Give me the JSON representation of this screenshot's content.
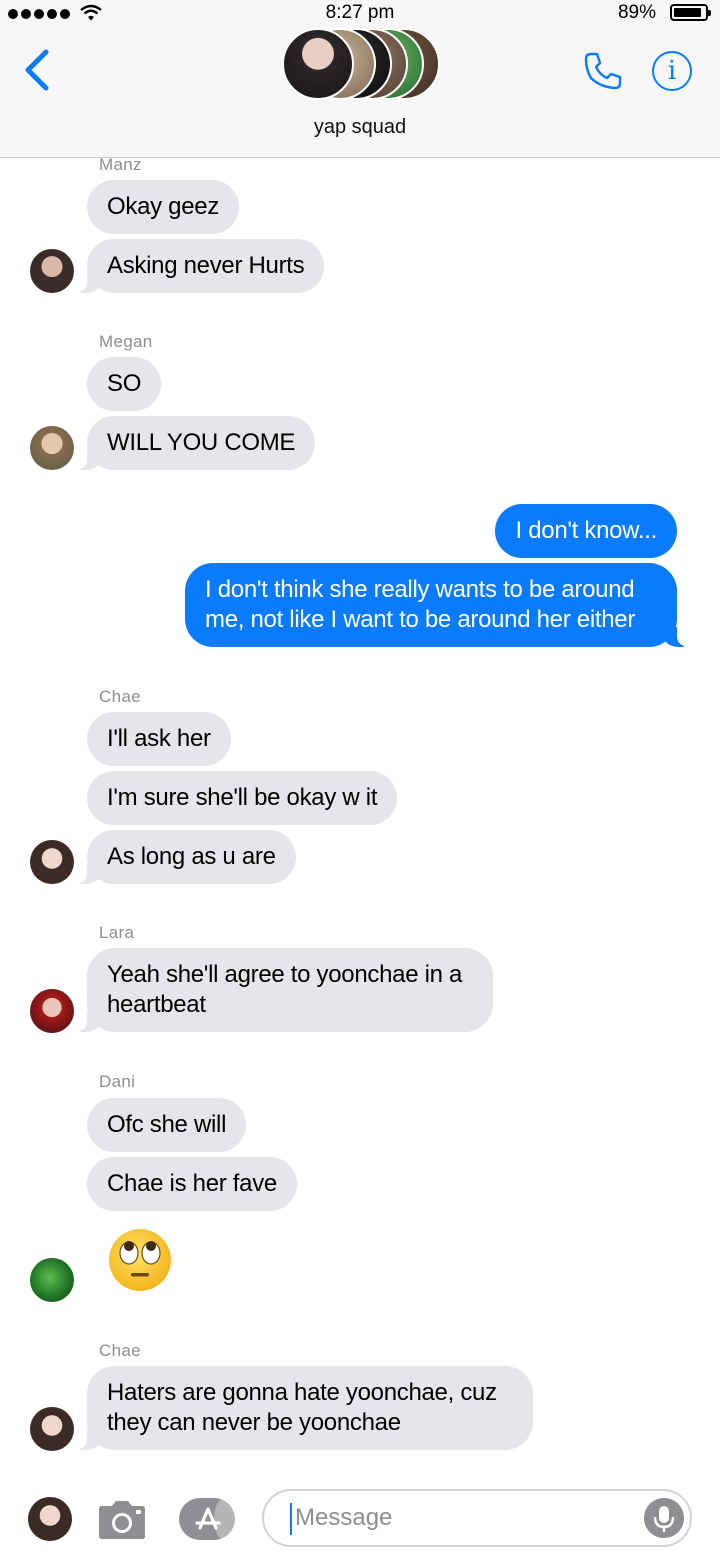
{
  "status_bar": {
    "time": "8:27 pm",
    "battery_percent": "89%",
    "battery_level": 0.89,
    "signal_bars": 5
  },
  "header": {
    "title": "yap squad",
    "back_icon": "chevron-left-icon",
    "call_icon": "phone-icon",
    "info_icon": "info-icon",
    "info_glyph": "i",
    "accent_color": "#0a7bff"
  },
  "messages": [
    {
      "sender": "Manz",
      "texts": [
        "Okay geez",
        "Asking never Hurts"
      ]
    },
    {
      "sender": "Megan",
      "texts": [
        "SO",
        "WILL YOU COME"
      ]
    },
    {
      "sender": "me",
      "texts": [
        "I don't know...",
        "I don't think she really wants to be around me, not like I want to be around her either"
      ]
    },
    {
      "sender": "Chae",
      "texts": [
        "I'll ask her",
        "I'm sure she'll be okay w it",
        "As long as u are"
      ]
    },
    {
      "sender": "Lara",
      "texts": [
        "Yeah she'll agree to yoonchae in a heartbeat"
      ]
    },
    {
      "sender": "Dani",
      "texts": [
        "Ofc she will",
        "Chae is her fave"
      ],
      "emoji": "face-with-rolling-eyes"
    },
    {
      "sender": "Chae",
      "texts": [
        "Haters are gonna hate yoonchae, cuz they can never be yoonchae"
      ]
    }
  ],
  "composer": {
    "placeholder": "Message",
    "camera_icon": "camera-icon",
    "app_store_icon": "app-store-icon",
    "mic_icon": "microphone-icon"
  },
  "colors": {
    "incoming_bubble": "#e5e5ea",
    "outgoing_bubble": "#0a7bff",
    "sender_label": "#8e8e93"
  }
}
